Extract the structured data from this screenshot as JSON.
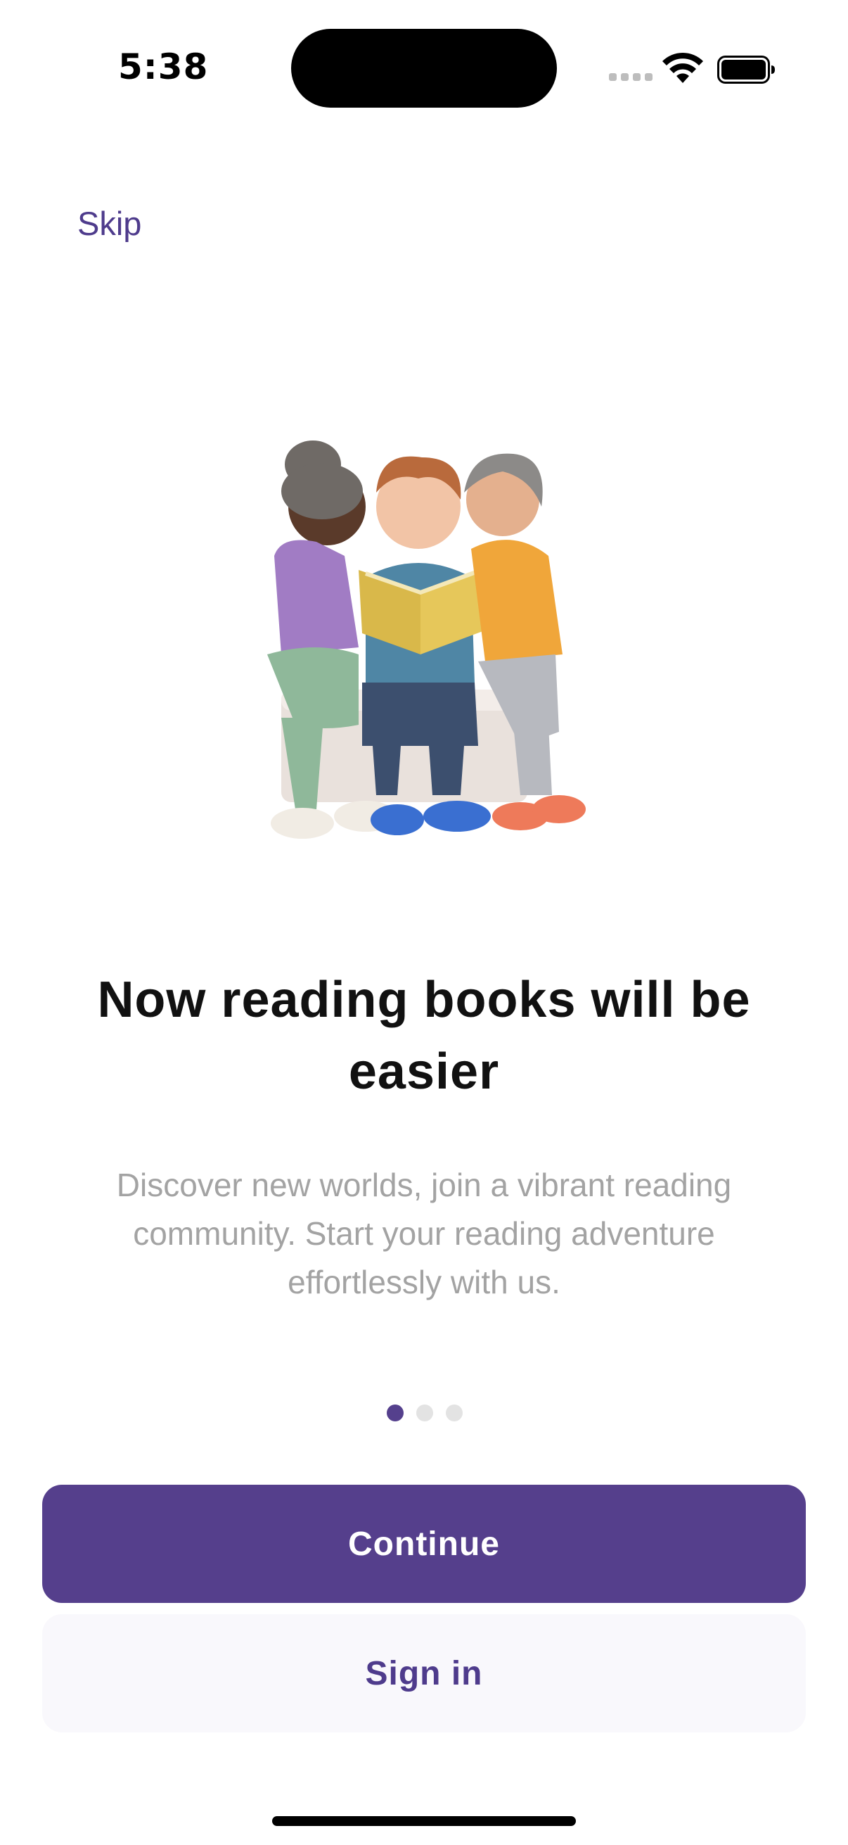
{
  "status_bar": {
    "time": "5:38"
  },
  "onboarding": {
    "skip_label": "Skip",
    "illustration": "three friends reading a book together",
    "headline": "Now reading books will be easier",
    "description": "Discover new worlds, join a vibrant reading community. Start your reading adventure effortlessly with us.",
    "page_indicator": {
      "total": 3,
      "current": 1
    }
  },
  "actions": {
    "continue_label": "Continue",
    "signin_label": "Sign in"
  },
  "colors": {
    "accent": "#553f8c",
    "accent_text": "#4e3b8c",
    "secondary_button_bg": "#f9f8fc",
    "muted_text": "#a3a3a3"
  }
}
